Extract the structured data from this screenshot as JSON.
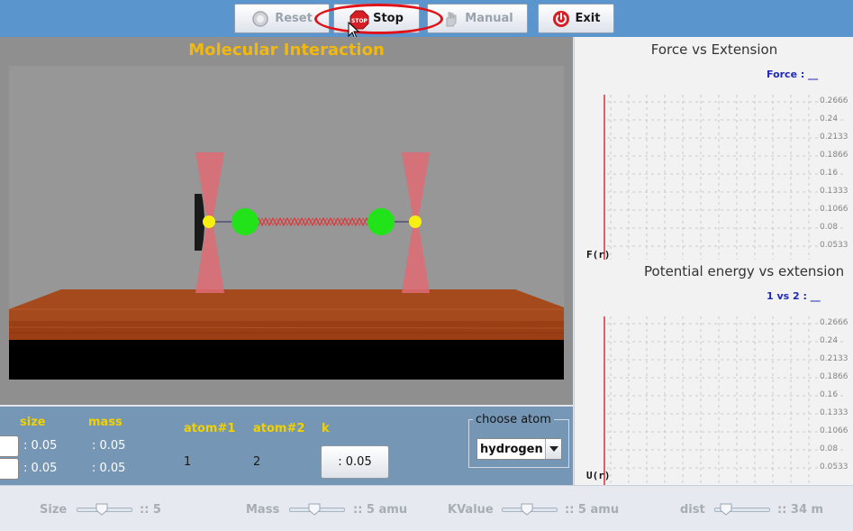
{
  "toolbar": {
    "reset_label": "Reset",
    "stop_label": "Stop",
    "stop_icon_text": "STOP",
    "manual_label": "Manual",
    "exit_label": "Exit"
  },
  "simulation": {
    "title": "Molecular Interaction"
  },
  "graphs": {
    "force": {
      "title": "Force vs Extension",
      "legend": "Force : __",
      "y_axis_label": "F(r)",
      "ticks": [
        "0.2666",
        "0.24",
        "0.2133",
        "0.1866",
        "0.16",
        "0.1333",
        "0.1066",
        "0.08",
        "0.0533"
      ]
    },
    "potential": {
      "title": "Potential energy vs extension",
      "legend": "1 vs 2 : __",
      "y_axis_label": "U(r)",
      "ticks": [
        "0.2666",
        "0.24",
        "0.2133",
        "0.1866",
        "0.16",
        "0.1333",
        "0.1066",
        "0.08",
        "0.0533"
      ]
    }
  },
  "controls": {
    "size_header": "size",
    "mass_header": "mass",
    "atom1_header": "atom#1",
    "atom2_header": "atom#2",
    "k_header": "k",
    "size_row1": ": 0.05",
    "size_row2": ": 0.05",
    "mass_row1": ": 0.05",
    "mass_row2": ": 0.05",
    "atom1_value": "1",
    "atom2_value": "2",
    "k_value": ": 0.05",
    "choose_atom_label": "choose atom",
    "choose_atom_value": "hydrogen"
  },
  "sliders": [
    {
      "label": "Size",
      "value": ":: 5",
      "position": 0.45
    },
    {
      "label": "Mass",
      "value": ":: 5 amu",
      "position": 0.45
    },
    {
      "label": "KValue",
      "value": ":: 5 amu",
      "position": 0.45
    },
    {
      "label": "dist",
      "value": ":: 34 m",
      "position": 0.2
    }
  ],
  "colors": {
    "toolbar_bg": "#5b95cd",
    "title_yellow": "#f2b80c",
    "atom_green": "#22e31a",
    "bead_yellow": "#f7ee12",
    "spring_red": "#e8292b",
    "laser_pink": "#e06b72",
    "table_wood": "#a5471b",
    "highlight_red": "#e0131a",
    "controls_bg": "#7596b4"
  }
}
